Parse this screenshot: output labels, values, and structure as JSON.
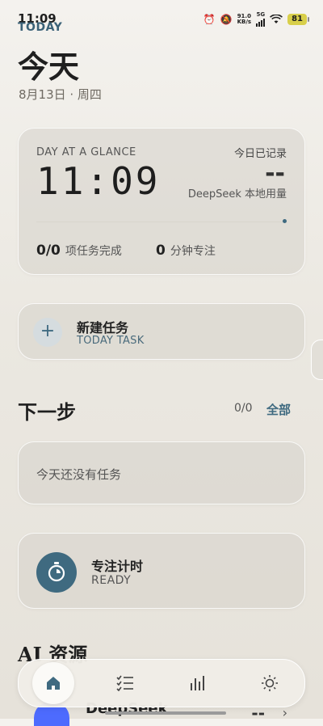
{
  "status_bar": {
    "time": "11:09",
    "overlay_label": "TODAY",
    "net_speed_value": "91.0",
    "net_speed_unit": "KB/s",
    "network_type": "5G",
    "battery": "81",
    "icons": [
      "alarm-icon",
      "mute-icon",
      "signal-icon",
      "wifi-icon",
      "battery-icon"
    ]
  },
  "header": {
    "title": "今天",
    "date": "8月13日 · 周四"
  },
  "glance": {
    "label": "DAY AT A GLANCE",
    "time": "11:09",
    "recorded_label": "今日已记录",
    "recorded_value": "--",
    "usage_label": "DeepSeek 本地用量",
    "progress": 1.0,
    "tasks_value": "0/0",
    "tasks_label": "项任务完成",
    "focus_value": "0",
    "focus_label": "分钟专注"
  },
  "new_task": {
    "icon": "plus-icon",
    "title": "新建任务",
    "subtitle": "TODAY TASK"
  },
  "next_step": {
    "title": "下一步",
    "count": "0/0",
    "all_label": "全部",
    "empty_text": "今天还没有任务"
  },
  "focus_timer": {
    "icon": "stopwatch-icon",
    "title": "专注计时",
    "status": "READY"
  },
  "ai_resources": {
    "title": "AI 资源",
    "items": [
      {
        "name": "DeepSeek",
        "value": "--",
        "icon": "deepseek-logo-icon"
      }
    ]
  },
  "bottom_nav": {
    "items": [
      {
        "icon": "home-icon",
        "active": true
      },
      {
        "icon": "checklist-icon",
        "active": false
      },
      {
        "icon": "bar-chart-icon",
        "active": false
      },
      {
        "icon": "sun-icon",
        "active": false
      }
    ]
  },
  "colors": {
    "accent": "#3f6a80",
    "battery": "#d8cf4a",
    "deepseek_brand": "#4d6bfe"
  }
}
